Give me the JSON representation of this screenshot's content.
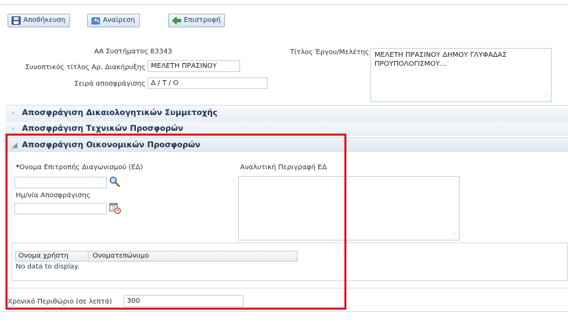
{
  "toolbar": {
    "save_label": "Αποθήκευση",
    "undo_label": "Αναίρεση",
    "back_label": "Επιστροφή"
  },
  "form": {
    "system_no_label": "ΑΑ Συστήματος",
    "system_no_value": "83343",
    "short_title_label": "Συνοπτικός τίτλος Αρ. Διακήρυξης",
    "short_title_value": "ΜΕΛΕΤΗ ΠΡΑΣΙΝΟΥ",
    "unseal_order_label": "Σειρά αποσφράγισης",
    "unseal_order_value": "Δ / Τ / Ο",
    "project_title_label": "Τίτλος Έργου/Μελέτης",
    "project_title_value": "ΜΕΛΕΤΗ ΠΡΑΣΙΝΟΥ ΔΗΜΟΥ ΓΛΥΦΑΔΑΣ ΠΡΟΥΠΟΛΟΓΙΣΜΟΥ..."
  },
  "sections": {
    "qualifications": "Αποσφράγιση Δικαιολογητικών Συμμετοχής",
    "technical": "Αποσφράγιση Τεχνικών Προσφορών",
    "financial": "Αποσφράγιση Οικονομικών Προσφορών"
  },
  "financial_panel": {
    "committee_required_mark": "*",
    "committee_label": "Ονομα Επιτροπής Διαγωνισμού (ΕΔ)",
    "committee_value": "",
    "date_label": "Ημ/νία Αποσφράγισης",
    "date_value": "",
    "description_label": "Αναλυτική Περιγραφή ΕΔ",
    "description_value": "",
    "table": {
      "columns": [
        "Ονομα χρήστη",
        "Ονοματεπώνυμο"
      ],
      "empty_text": "No data to display."
    }
  },
  "time_limit": {
    "label": "Χρονικό Περιθώριο (σε λεπτά)",
    "value": "300"
  },
  "colors": {
    "highlight": "#e4141a",
    "section_text": "#1a3350"
  }
}
